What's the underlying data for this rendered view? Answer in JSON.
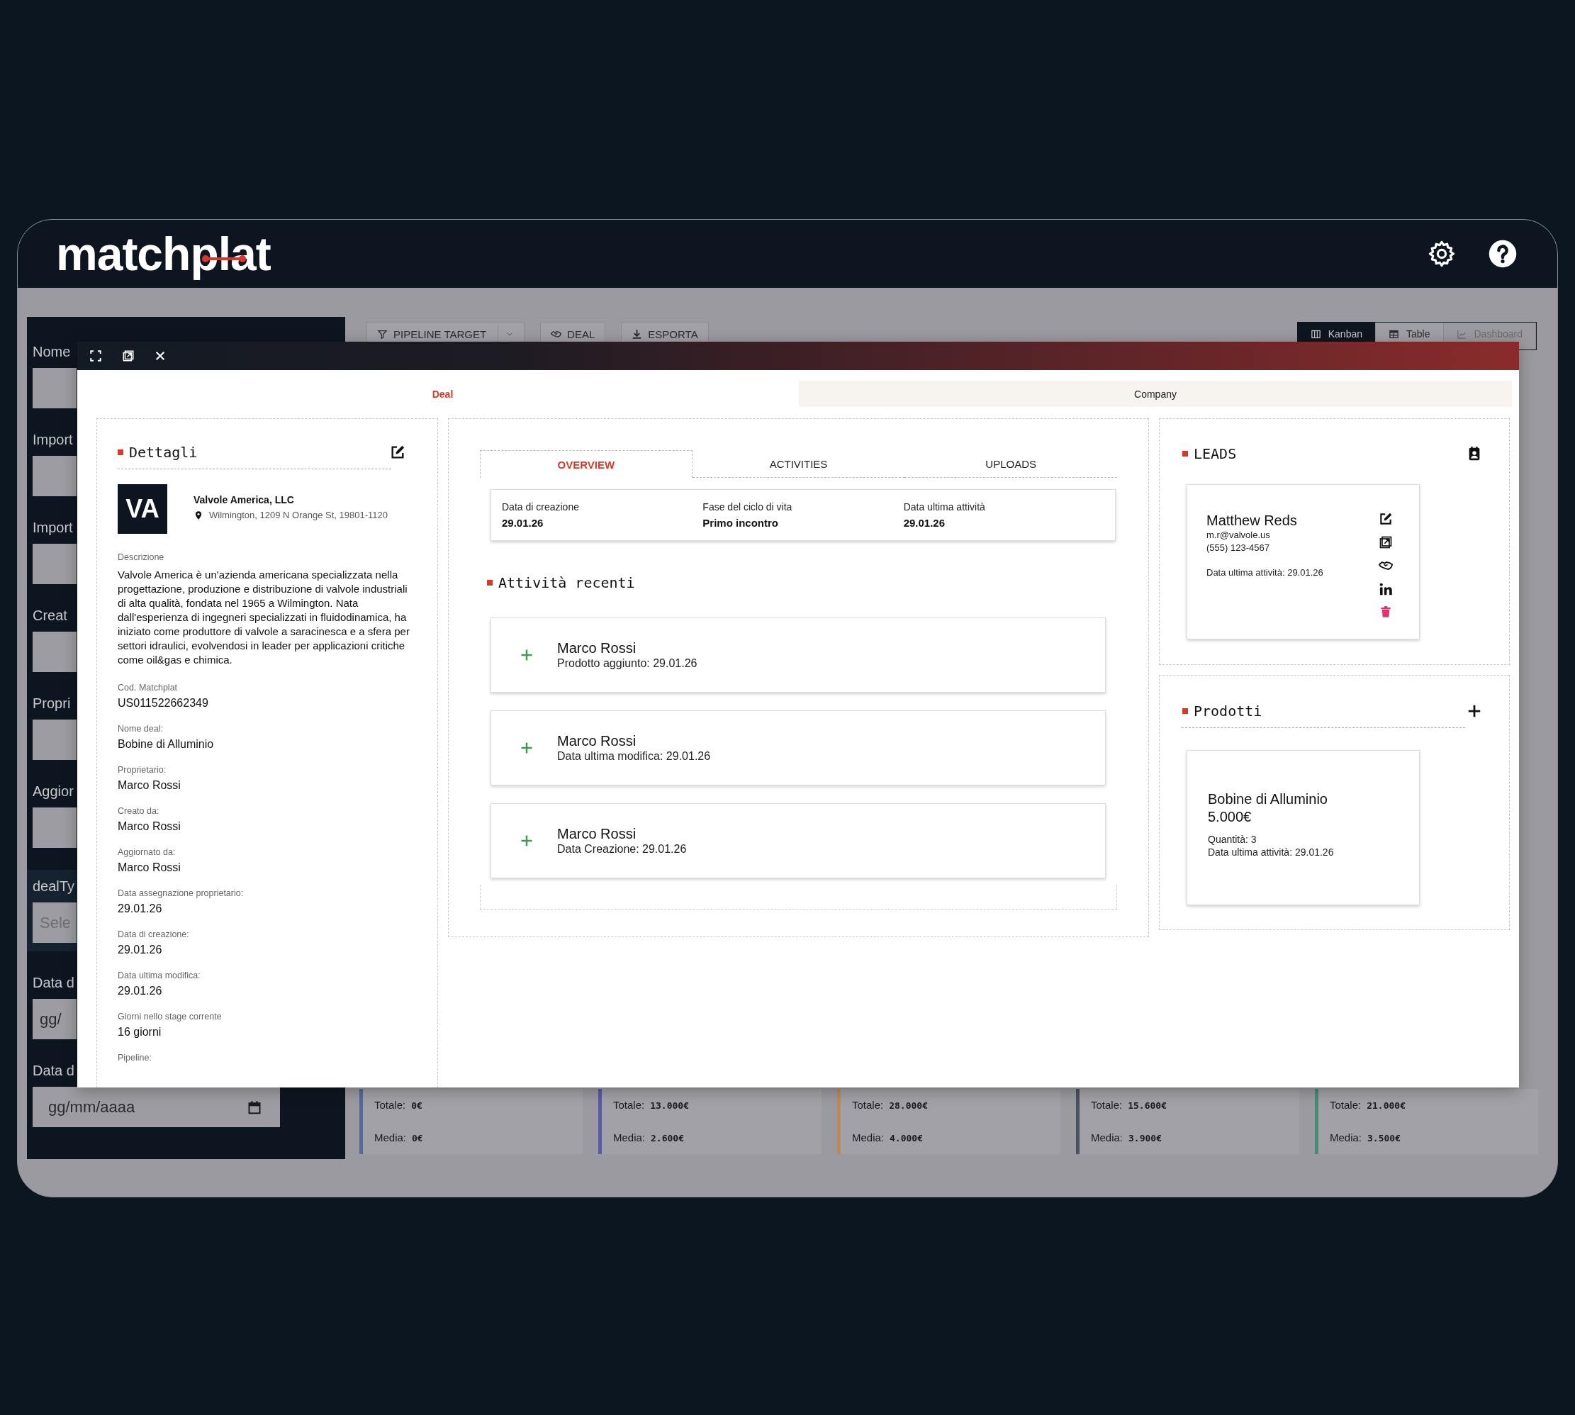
{
  "header": {
    "logo": "matchplat"
  },
  "sidebar": {
    "fields": [
      {
        "label": "Nome",
        "kind": "input"
      },
      {
        "label": "Import",
        "kind": "input"
      },
      {
        "label": "Import",
        "kind": "input"
      },
      {
        "label": "Creat",
        "kind": "input"
      },
      {
        "label": "Propri",
        "kind": "input"
      },
      {
        "label": "Aggior",
        "kind": "input"
      },
      {
        "label": "dealTy",
        "kind": "select",
        "placeholder": "Sele"
      },
      {
        "label": "Data d",
        "kind": "input",
        "value": "gg/"
      },
      {
        "label": "Data d",
        "kind": "date",
        "value": "gg/mm/aaaa"
      }
    ]
  },
  "toolbar": {
    "buttons": [
      {
        "label": "PIPELINE TARGET",
        "kind": "dropdown"
      },
      {
        "label": "DEAL",
        "kind": "plain"
      },
      {
        "label": "ESPORTA",
        "kind": "plain"
      }
    ]
  },
  "view_switch": [
    {
      "label": "Kanban",
      "selected": true,
      "disabled": false
    },
    {
      "label": "Table",
      "selected": false,
      "disabled": false
    },
    {
      "label": "Dashboard",
      "selected": false,
      "disabled": true
    }
  ],
  "kanban_totals": [
    {
      "color": "#5268a5",
      "total_label": "Totale:",
      "total": "0€",
      "average_label": "Media:",
      "average": "0€"
    },
    {
      "color": "#5a5ba0",
      "total_label": "Totale:",
      "total": "13.000€",
      "average_label": "Media:",
      "average": "2.600€"
    },
    {
      "color": "#c28a4a",
      "total_label": "Totale:",
      "total": "28.000€",
      "average_label": "Media:",
      "average": "4.000€"
    },
    {
      "color": "#4a5260",
      "total_label": "Totale:",
      "total": "15.600€",
      "average_label": "Media:",
      "average": "3.900€"
    },
    {
      "color": "#3e8f76",
      "total_label": "Totale:",
      "total": "21.000€",
      "average_label": "Media:",
      "average": "3.500€"
    }
  ],
  "modal": {
    "tabs": [
      {
        "label": "Deal",
        "selected": true
      },
      {
        "label": "Company",
        "selected": false
      }
    ],
    "details": {
      "title": "Dettagli",
      "company": {
        "initials": "VA",
        "name": "Valvole America, LLC",
        "address": "Wilmington, 1209 N Orange St, 19801-1120"
      },
      "description_label": "Descrizione",
      "description": "Valvole America è un'azienda americana specializzata nella progettazione, produzione e distribuzione di valvole industriali di alta qualità, fondata nel 1965 a Wilmington. Nata dall'esperienza di ingegneri specializzati in fluidodinamica, ha iniziato come produttore di valvole a saracinesca e a sfera per settori idraulici, evolvendosi in leader per applicazioni critiche come oil&gas e chimica.",
      "fields": [
        {
          "label": "Cod. Matchplat",
          "value": "US011522662349"
        },
        {
          "label": "Nome deal:",
          "value": "Bobine di Alluminio"
        },
        {
          "label": "Proprietario:",
          "value": "Marco Rossi"
        },
        {
          "label": "Creato da:",
          "value": "Marco Rossi"
        },
        {
          "label": "Aggiornato da:",
          "value": "Marco Rossi"
        },
        {
          "label": "Data assegnazione proprietario:",
          "value": "29.01.26"
        },
        {
          "label": "Data di creazione:",
          "value": "29.01.26"
        },
        {
          "label": "Data ultima modifica:",
          "value": "29.01.26"
        },
        {
          "label": "Giorni nello stage corrente",
          "value": "16 giorni"
        },
        {
          "label": "Pipeline:"
        }
      ]
    },
    "overview": {
      "tabs": [
        {
          "label": "OVERVIEW",
          "selected": true
        },
        {
          "label": "ACTIVITIES",
          "selected": false
        },
        {
          "label": "UPLOADS",
          "selected": false
        }
      ],
      "summary": [
        {
          "label": "Data di creazione",
          "value": "29.01.26"
        },
        {
          "label": "Fase del ciclo di vita",
          "value": "Primo incontro"
        },
        {
          "label": "Data ultima attività",
          "value": "29.01.26"
        }
      ],
      "recent_title": "Attività recenti",
      "activities": [
        {
          "name": "Marco Rossi",
          "detail": "Prodotto aggiunto: 29.01.26"
        },
        {
          "name": "Marco Rossi",
          "detail": "Data ultima modifica: 29.01.26"
        },
        {
          "name": "Marco Rossi",
          "detail": "Data Creazione: 29.01.26"
        }
      ]
    },
    "leads": {
      "title": "LEADS",
      "items": [
        {
          "name": "Matthew Reds",
          "email": "m.r@valvole.us",
          "phone": "(555) 123-4567",
          "last_activity": "Data ultima attività: 29.01.26"
        }
      ]
    },
    "products": {
      "title": "Prodotti",
      "items": [
        {
          "name": "Bobine di Alluminio",
          "price": "5.000€",
          "quantity": "Quantità: 3",
          "last_activity": "Data ultima attività: 29.01.26"
        }
      ]
    }
  }
}
